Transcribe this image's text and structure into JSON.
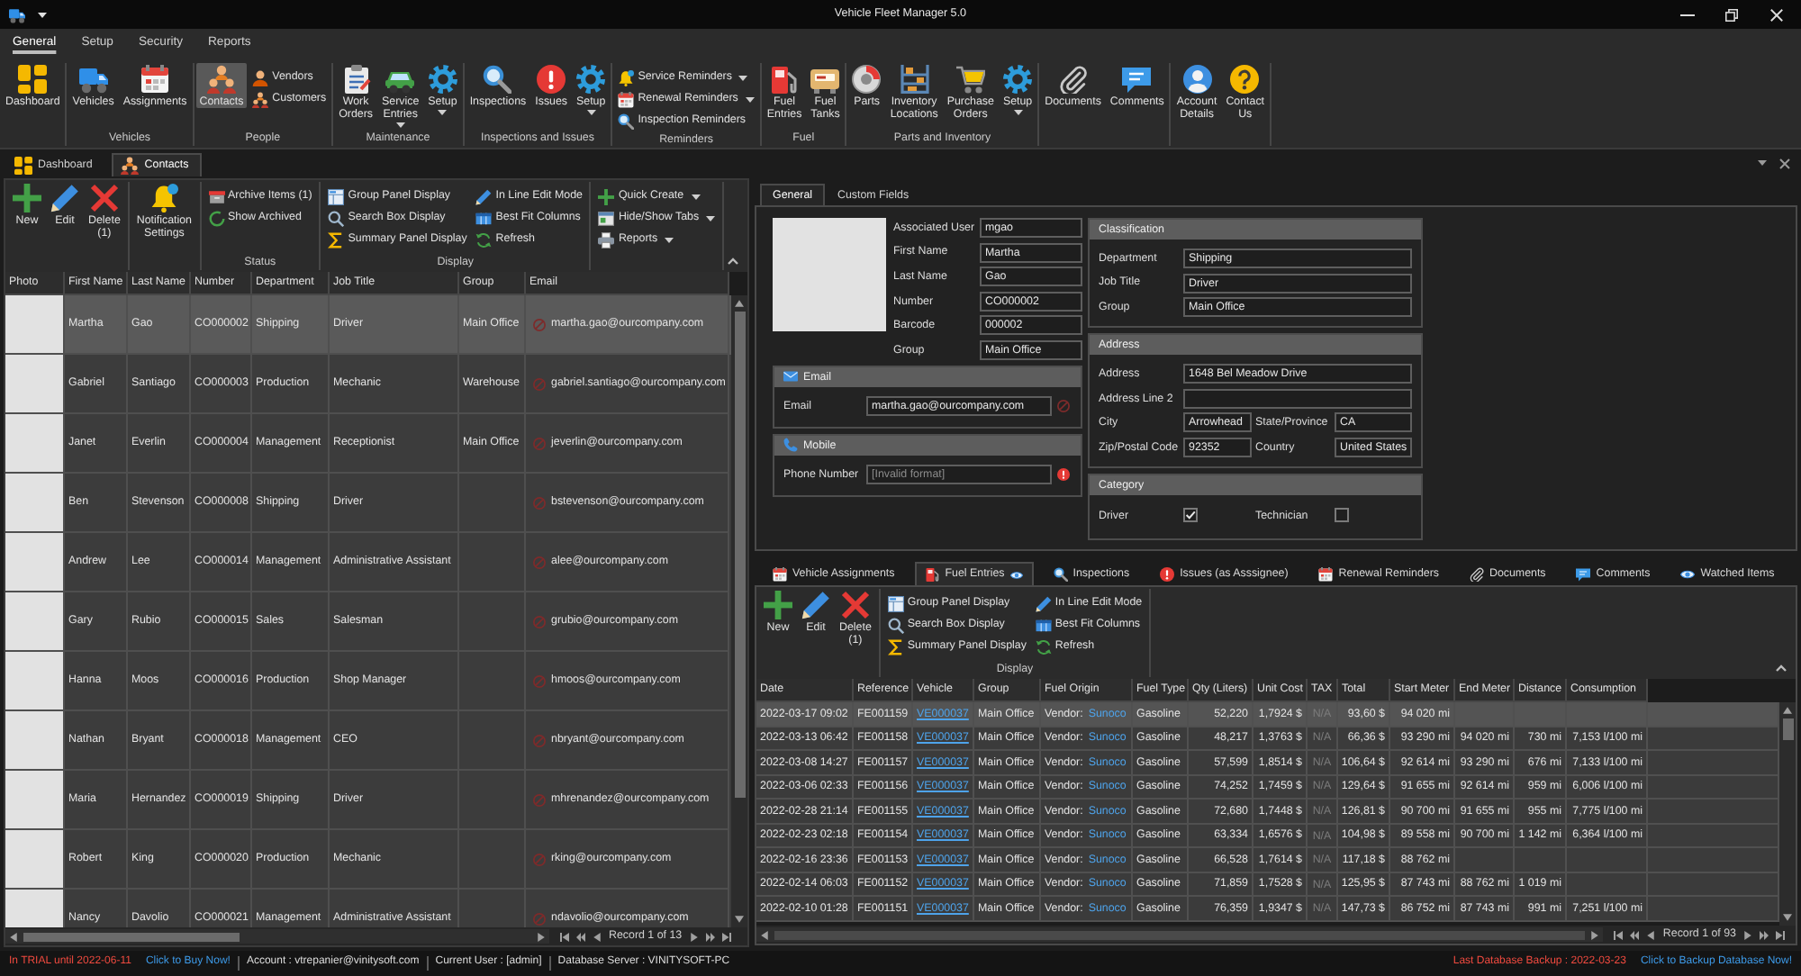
{
  "window": {
    "title": "Vehicle Fleet Manager 5.0"
  },
  "ribbon": {
    "tabs": [
      {
        "label": "General",
        "selected": true
      },
      {
        "label": "Setup",
        "selected": false
      },
      {
        "label": "Security",
        "selected": false
      },
      {
        "label": "Reports",
        "selected": false
      }
    ],
    "groups": [
      {
        "items": [
          {
            "label": "Dashboard",
            "kind": "large",
            "selected": false
          }
        ]
      },
      {
        "label": "Vehicles",
        "items": [
          {
            "label": "Vehicles",
            "kind": "large",
            "selected": false
          },
          {
            "label": "Assignments",
            "kind": "large",
            "selected": false
          }
        ]
      },
      {
        "label": "People",
        "items": [
          {
            "label": "Contacts",
            "kind": "large",
            "selected": true
          },
          {
            "label": "Vendors",
            "kind": "small",
            "selected": false
          },
          {
            "label": "Customers",
            "kind": "small",
            "selected": false
          }
        ]
      },
      {
        "label": "Maintenance",
        "items": [
          {
            "label": "Work Orders",
            "kind": "large",
            "selected": false
          },
          {
            "label": "Service Entries",
            "kind": "large",
            "dropdown": true,
            "selected": false
          },
          {
            "label": "Setup",
            "kind": "large",
            "dropdown": true,
            "selected": false
          }
        ]
      },
      {
        "label": "Inspections and Issues",
        "items": [
          {
            "label": "Inspections",
            "kind": "large",
            "selected": false
          },
          {
            "label": "Issues",
            "kind": "large",
            "selected": false
          },
          {
            "label": "Setup",
            "kind": "large",
            "dropdown": true,
            "selected": false
          }
        ]
      },
      {
        "label": "Reminders",
        "items": [
          {
            "label": "Service Reminders",
            "kind": "small",
            "dropdown": true,
            "selected": false
          },
          {
            "label": "Renewal Reminders",
            "kind": "small",
            "dropdown": true,
            "selected": false
          },
          {
            "label": "Inspection Reminders",
            "kind": "small",
            "selected": false
          }
        ]
      },
      {
        "label": "Fuel",
        "items": [
          {
            "label": "Fuel Entries",
            "kind": "large",
            "selected": false
          },
          {
            "label": "Fuel Tanks",
            "kind": "large",
            "selected": false
          }
        ]
      },
      {
        "label": "Parts and Inventory",
        "items": [
          {
            "label": "Parts",
            "kind": "large",
            "selected": false
          },
          {
            "label": "Inventory Locations",
            "kind": "large",
            "selected": false
          },
          {
            "label": "Purchase Orders",
            "kind": "large",
            "selected": false
          },
          {
            "label": "Setup",
            "kind": "large",
            "dropdown": true,
            "selected": false
          }
        ]
      },
      {
        "items": [
          {
            "label": "Documents",
            "kind": "large",
            "selected": false
          },
          {
            "label": "Comments",
            "kind": "large",
            "selected": false
          }
        ]
      },
      {
        "items": [
          {
            "label": "Account Details",
            "kind": "large",
            "selected": false
          },
          {
            "label": "Contact Us",
            "kind": "large",
            "selected": false
          }
        ]
      }
    ]
  },
  "doc_tabs": [
    {
      "label": "Dashboard",
      "selected": false
    },
    {
      "label": "Contacts",
      "selected": true
    }
  ],
  "contacts": {
    "toolbar": {
      "groups": [
        {
          "items": [
            {
              "label": "New",
              "kind": "large"
            },
            {
              "label": "Edit",
              "kind": "large"
            },
            {
              "label": "Delete (1)",
              "kind": "large"
            }
          ]
        },
        {
          "items": [
            {
              "label": "Notification Settings",
              "kind": "large"
            }
          ]
        },
        {
          "label": "Status",
          "items": [
            {
              "label": "Archive Items (1)",
              "kind": "small"
            },
            {
              "label": "Show Archived",
              "kind": "small"
            }
          ]
        },
        {
          "label": "Display",
          "items": [
            {
              "label": "Group Panel Display",
              "kind": "small"
            },
            {
              "label": "Search Box Display",
              "kind": "small"
            },
            {
              "label": "Summary Panel Display",
              "kind": "small"
            },
            {
              "label": "In Line Edit Mode",
              "kind": "small"
            },
            {
              "label": "Best Fit Columns",
              "kind": "small"
            },
            {
              "label": "Refresh",
              "kind": "small"
            }
          ]
        },
        {
          "items": [
            {
              "label": "Quick Create",
              "kind": "small",
              "dropdown": true
            },
            {
              "label": "Hide/Show Tabs",
              "kind": "small",
              "dropdown": true
            },
            {
              "label": "Reports",
              "kind": "small",
              "dropdown": true
            }
          ]
        }
      ]
    },
    "table": {
      "columns": [
        "Photo",
        "First Name",
        "Last Name",
        "Number",
        "Department",
        "Job Title",
        "Group",
        "Email"
      ],
      "rows": [
        {
          "selected": true,
          "first_name": "Martha",
          "last_name": "Gao",
          "number": "CO000002",
          "department": "Shipping",
          "job_title": "Driver",
          "group": "Main Office",
          "email": "martha.gao@ourcompany.com"
        },
        {
          "selected": false,
          "first_name": "Gabriel",
          "last_name": "Santiago",
          "number": "CO000003",
          "department": "Production",
          "job_title": "Mechanic",
          "group": "Warehouse",
          "email": "gabriel.santiago@ourcompany.com"
        },
        {
          "selected": false,
          "first_name": "Janet",
          "last_name": "Everlin",
          "number": "CO000004",
          "department": "Management",
          "job_title": "Receptionist",
          "group": "Main Office",
          "email": "jeverlin@ourcompany.com"
        },
        {
          "selected": false,
          "first_name": "Ben",
          "last_name": "Stevenson",
          "number": "CO000008",
          "department": "Shipping",
          "job_title": "Driver",
          "email": "bstevenson@ourcompany.com"
        },
        {
          "selected": false,
          "first_name": "Andrew",
          "last_name": "Lee",
          "number": "CO000014",
          "department": "Management",
          "job_title": "Administrative Assistant",
          "email": "alee@ourcompany.com"
        },
        {
          "selected": false,
          "first_name": "Gary",
          "last_name": "Rubio",
          "number": "CO000015",
          "department": "Sales",
          "job_title": "Salesman",
          "email": "grubio@ourcompany.com"
        },
        {
          "selected": false,
          "first_name": "Hanna",
          "last_name": "Moos",
          "number": "CO000016",
          "department": "Production",
          "job_title": "Shop Manager",
          "email": "hmoos@ourcompany.com"
        },
        {
          "selected": false,
          "first_name": "Nathan",
          "last_name": "Bryant",
          "number": "CO000018",
          "department": "Management",
          "job_title": "CEO",
          "email": "nbryant@ourcompany.com"
        },
        {
          "selected": false,
          "first_name": "Maria",
          "last_name": "Hernandez",
          "number": "CO000019",
          "department": "Shipping",
          "job_title": "Driver",
          "email": "mhrenandez@ourcompany.com"
        },
        {
          "selected": false,
          "first_name": "Robert",
          "last_name": "King",
          "number": "CO000020",
          "department": "Production",
          "job_title": "Mechanic",
          "email": "rking@ourcompany.com"
        },
        {
          "selected": false,
          "first_name": "Nancy",
          "last_name": "Davolio",
          "number": "CO000021",
          "department": "Management",
          "job_title": "Administrative Assistant",
          "email": "ndavolio@ourcompany.com"
        }
      ]
    },
    "pager": "Record 1 of 13"
  },
  "details": {
    "tabs": [
      {
        "label": "General",
        "selected": true
      },
      {
        "label": "Custom Fields",
        "selected": false
      }
    ],
    "fields": [
      {
        "label": "Associated User",
        "value": "mgao"
      },
      {
        "label": "First Name",
        "value": "Martha"
      },
      {
        "label": "Last Name",
        "value": "Gao"
      },
      {
        "label": "Number",
        "value": "CO000002"
      },
      {
        "label": "Barcode",
        "value": "000002"
      },
      {
        "label": "Group",
        "value": "Main Office"
      }
    ],
    "email": {
      "title": "Email",
      "fields": [
        {
          "label": "Email",
          "value": "martha.gao@ourcompany.com",
          "error": false
        }
      ]
    },
    "mobile": {
      "title": "Mobile",
      "fields": [
        {
          "label": "Phone Number",
          "placeholder": "[Invalid format]",
          "error": true
        }
      ]
    },
    "classification": {
      "title": "Classification",
      "fields": [
        {
          "label": "Department",
          "value": "Shipping"
        },
        {
          "label": "Job Title",
          "value": "Driver"
        },
        {
          "label": "Group",
          "value": "Main Office"
        }
      ]
    },
    "address": {
      "title": "Address",
      "fields": [
        {
          "label": "Address",
          "value": "1648 Bel Meadow Drive"
        },
        {
          "label": "Address Line 2"
        },
        {
          "label": "City",
          "value": "Arrowhead"
        },
        {
          "label": "State/Province",
          "value": "CA"
        },
        {
          "label": "Zip/Postal Code",
          "value": "92352"
        },
        {
          "label": "Country",
          "value": "United States"
        }
      ]
    },
    "category": {
      "title": "Category",
      "options": [
        {
          "label": "Driver",
          "checked": true
        },
        {
          "label": "Technician",
          "checked": false
        }
      ]
    }
  },
  "related": {
    "tabs": [
      {
        "label": "Vehicle Assignments",
        "selected": false
      },
      {
        "label": "Fuel Entries",
        "selected": true
      },
      {
        "label": "Inspections",
        "selected": false
      },
      {
        "label": "Issues (as Asssignee)",
        "selected": false
      },
      {
        "label": "Renewal Reminders",
        "selected": false
      },
      {
        "label": "Documents",
        "selected": false
      },
      {
        "label": "Comments",
        "selected": false
      },
      {
        "label": "Watched Items",
        "selected": false
      }
    ],
    "toolbar": {
      "groups": [
        {
          "items": [
            {
              "label": "New",
              "kind": "large"
            },
            {
              "label": "Edit",
              "kind": "large"
            },
            {
              "label": "Delete (1)",
              "kind": "large"
            }
          ]
        },
        {
          "label": "Display",
          "items": [
            {
              "label": "Group Panel Display",
              "kind": "small"
            },
            {
              "label": "Search Box Display",
              "kind": "small"
            },
            {
              "label": "Summary Panel Display",
              "kind": "small"
            },
            {
              "label": "In Line Edit Mode",
              "kind": "small"
            },
            {
              "label": "Best Fit Columns",
              "kind": "small"
            },
            {
              "label": "Refresh",
              "kind": "small"
            }
          ]
        }
      ]
    },
    "table": {
      "columns": [
        "Date",
        "Reference",
        "Vehicle",
        "Group",
        "Fuel Origin",
        "Fuel Type",
        "Qty (Liters)",
        "Unit Cost",
        "TAX",
        "Total",
        "Start Meter",
        "End Meter",
        "Distance",
        "Consumption"
      ],
      "rows": [
        {
          "selected": true,
          "date": "2022-03-17 09:02",
          "reference": "FE001159",
          "vehicle": "VE000037",
          "group": "Main Office",
          "origin_type": "Vendor:",
          "origin": "Sunoco",
          "fuel_type": "Gasoline",
          "qty": "52,220",
          "unit_cost": "1,7924 $",
          "tax": {
            "placeholder": "N/A"
          },
          "total": "93,60 $",
          "start_meter": "94 020 mi"
        },
        {
          "selected": false,
          "date": "2022-03-13 06:42",
          "reference": "FE001158",
          "vehicle": "VE000037",
          "group": "Main Office",
          "origin_type": "Vendor:",
          "origin": "Sunoco",
          "fuel_type": "Gasoline",
          "qty": "48,217",
          "unit_cost": "1,3763 $",
          "tax": {
            "placeholder": "N/A"
          },
          "total": "66,36 $",
          "start_meter": "93 290 mi",
          "end_meter": "94 020 mi",
          "distance": "730 mi",
          "consumption": "7,153 l/100 mi"
        },
        {
          "selected": false,
          "date": "2022-03-08 14:27",
          "reference": "FE001157",
          "vehicle": "VE000037",
          "group": "Main Office",
          "origin_type": "Vendor:",
          "origin": "Sunoco",
          "fuel_type": "Gasoline",
          "qty": "57,599",
          "unit_cost": "1,8514 $",
          "tax": {
            "placeholder": "N/A"
          },
          "total": "106,64 $",
          "start_meter": "92 614 mi",
          "end_meter": "93 290 mi",
          "distance": "676 mi",
          "consumption": "7,133 l/100 mi"
        },
        {
          "selected": false,
          "date": "2022-03-06 02:33",
          "reference": "FE001156",
          "vehicle": "VE000037",
          "group": "Main Office",
          "origin_type": "Vendor:",
          "origin": "Sunoco",
          "fuel_type": "Gasoline",
          "qty": "74,252",
          "unit_cost": "1,7459 $",
          "tax": {
            "placeholder": "N/A"
          },
          "total": "129,64 $",
          "start_meter": "91 655 mi",
          "end_meter": "92 614 mi",
          "distance": "959 mi",
          "consumption": "6,006 l/100 mi"
        },
        {
          "selected": false,
          "date": "2022-02-28 21:14",
          "reference": "FE001155",
          "vehicle": "VE000037",
          "group": "Main Office",
          "origin_type": "Vendor:",
          "origin": "Sunoco",
          "fuel_type": "Gasoline",
          "qty": "72,680",
          "unit_cost": "1,7448 $",
          "tax": {
            "placeholder": "N/A"
          },
          "total": "126,81 $",
          "start_meter": "90 700 mi",
          "end_meter": "91 655 mi",
          "distance": "955 mi",
          "consumption": "7,775 l/100 mi"
        },
        {
          "selected": false,
          "date": "2022-02-23 02:18",
          "reference": "FE001154",
          "vehicle": "VE000037",
          "group": "Main Office",
          "origin_type": "Vendor:",
          "origin": "Sunoco",
          "fuel_type": "Gasoline",
          "qty": "63,334",
          "unit_cost": "1,6576 $",
          "tax": {
            "placeholder": "N/A"
          },
          "total": "104,98 $",
          "start_meter": "89 558 mi",
          "end_meter": "90 700 mi",
          "distance": "1 142 mi",
          "consumption": "6,364 l/100 mi"
        },
        {
          "selected": false,
          "date": "2022-02-16 23:36",
          "reference": "FE001153",
          "vehicle": "VE000037",
          "group": "Main Office",
          "origin_type": "Vendor:",
          "origin": "Sunoco",
          "fuel_type": "Gasoline",
          "qty": "66,528",
          "unit_cost": "1,7614 $",
          "tax": {
            "placeholder": "N/A"
          },
          "total": "117,18 $",
          "start_meter": "88 762 mi"
        },
        {
          "selected": false,
          "date": "2022-02-14 06:03",
          "reference": "FE001152",
          "vehicle": "VE000037",
          "group": "Main Office",
          "origin_type": "Vendor:",
          "origin": "Sunoco",
          "fuel_type": "Gasoline",
          "qty": "71,859",
          "unit_cost": "1,7528 $",
          "tax": {
            "placeholder": "N/A"
          },
          "total": "125,95 $",
          "start_meter": "87 743 mi",
          "end_meter": "88 762 mi",
          "distance": "1 019 mi"
        },
        {
          "selected": false,
          "date": "2022-02-10 01:28",
          "reference": "FE001151",
          "vehicle": "VE000037",
          "group": "Main Office",
          "origin_type": "Vendor:",
          "origin": "Sunoco",
          "fuel_type": "Gasoline",
          "qty": "76,359",
          "unit_cost": "1,9347 $",
          "tax": {
            "placeholder": "N/A"
          },
          "total": "147,73 $",
          "start_meter": "86 752 mi",
          "end_meter": "87 743 mi",
          "distance": "991 mi",
          "consumption": "7,251 l/100 mi"
        }
      ]
    },
    "pager": "Record 1 of 93"
  },
  "status_bar": {
    "left": [
      {
        "text": "In TRIAL until 2022-06-11",
        "kind": "alert"
      },
      {
        "text": "Click to Buy Now!",
        "kind": "link"
      },
      {
        "text": "Account : vtrepanier@vinitysoft.com",
        "kind": "info"
      },
      {
        "text": "Current User : [admin]",
        "kind": "info"
      },
      {
        "text": "Database Server : VINITYSOFT-PC",
        "kind": "info"
      }
    ],
    "right": [
      {
        "text": "Last Database Backup : 2022-03-23",
        "kind": "alert"
      },
      {
        "text": "Click to Backup Database Now!",
        "kind": "link"
      }
    ]
  }
}
